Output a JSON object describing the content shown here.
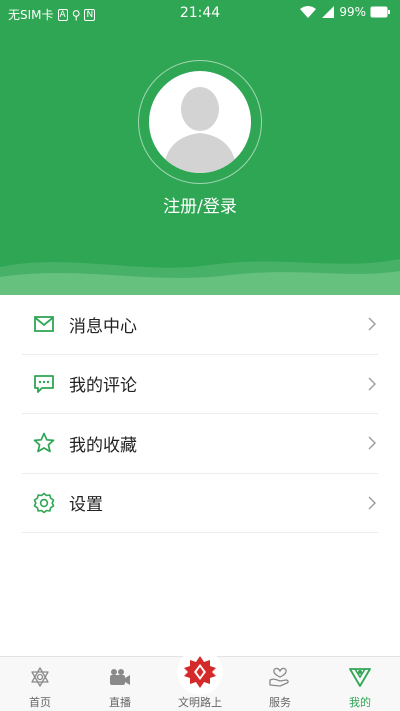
{
  "status_bar": {
    "carrier": "无SIM卡",
    "time": "21:44",
    "battery": "99%"
  },
  "profile": {
    "login_label": "注册/登录"
  },
  "menu": {
    "items": [
      {
        "label": "消息中心",
        "icon": "mail-icon"
      },
      {
        "label": "我的评论",
        "icon": "comment-icon"
      },
      {
        "label": "我的收藏",
        "icon": "star-icon"
      },
      {
        "label": "设置",
        "icon": "gear-icon"
      }
    ]
  },
  "tabbar": {
    "tabs": [
      {
        "label": "首页",
        "icon": "home-icon"
      },
      {
        "label": "直播",
        "icon": "live-icon"
      },
      {
        "label": "文明路上",
        "icon": "civilization-logo-icon"
      },
      {
        "label": "服务",
        "icon": "service-icon"
      },
      {
        "label": "我的",
        "icon": "mine-icon"
      }
    ],
    "active_index": 4
  },
  "colors": {
    "brand_green": "#2fa654",
    "accent_red": "#d42a2a"
  }
}
